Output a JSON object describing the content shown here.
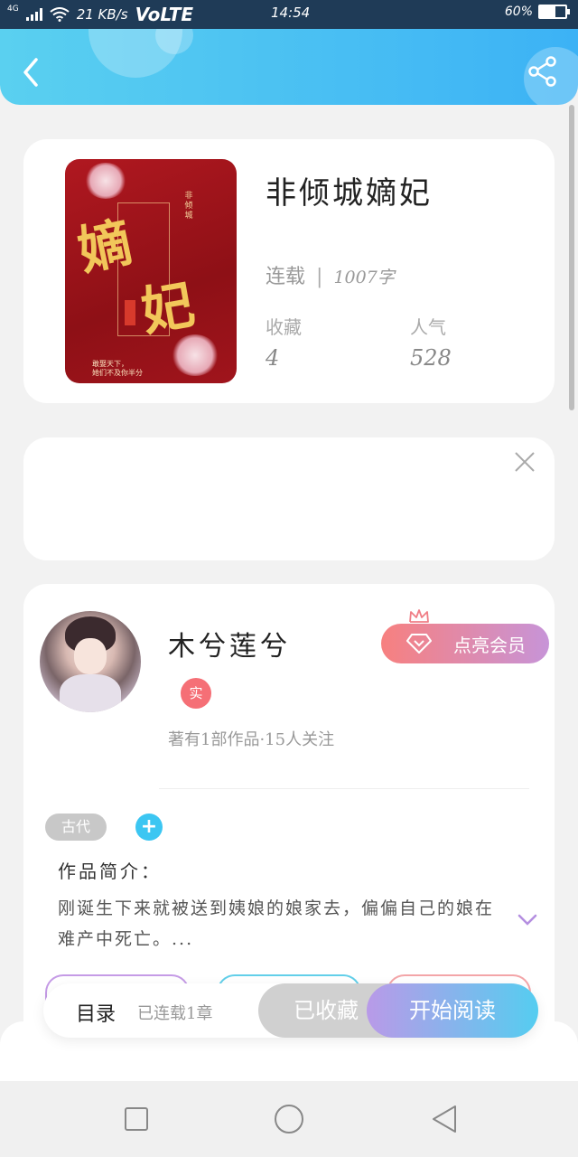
{
  "status_bar": {
    "network": "4G",
    "speed": "21 KB/s",
    "volte": "VoLTE",
    "time": "14:54",
    "battery": "60%",
    "battery_level": 0.6
  },
  "header": {
    "back_icon": "chevron-left-icon",
    "share_icon": "share-icon",
    "color_start": "#5ad0f0",
    "color_end": "#3cb2f5"
  },
  "book": {
    "title": "非倾城嫡妃",
    "status": "连载",
    "word_count": "1007字",
    "favorites_label": "收藏",
    "favorites": "4",
    "popularity_label": "人气",
    "popularity": "528",
    "cover": {
      "char1": "嫡",
      "char2": "妃",
      "series": "非倾城",
      "slogan_line1": "敢娶天下，",
      "slogan_line2": "她们不及你半分"
    }
  },
  "ad": {
    "close_icon": "close-icon"
  },
  "author": {
    "name": "木兮莲兮",
    "verified_badge": "实",
    "meta": "著有1部作品·15人关注",
    "vip_button": "点亮会员",
    "tag": "古代",
    "add_tag_symbol": "+",
    "intro_title": "作品简介：",
    "intro_text": "刚诞生下来就被送到姨娘的娘家去，偏偏自己的娘在难产中死亡。..."
  },
  "action_bar": {
    "toc_label": "目录",
    "toc_info": "已连载1章",
    "collected_label": "已收藏",
    "read_label": "开始阅读"
  },
  "nav": {
    "recent_icon": "square-icon",
    "home_icon": "circle-icon",
    "back_icon": "triangle-back-icon"
  }
}
